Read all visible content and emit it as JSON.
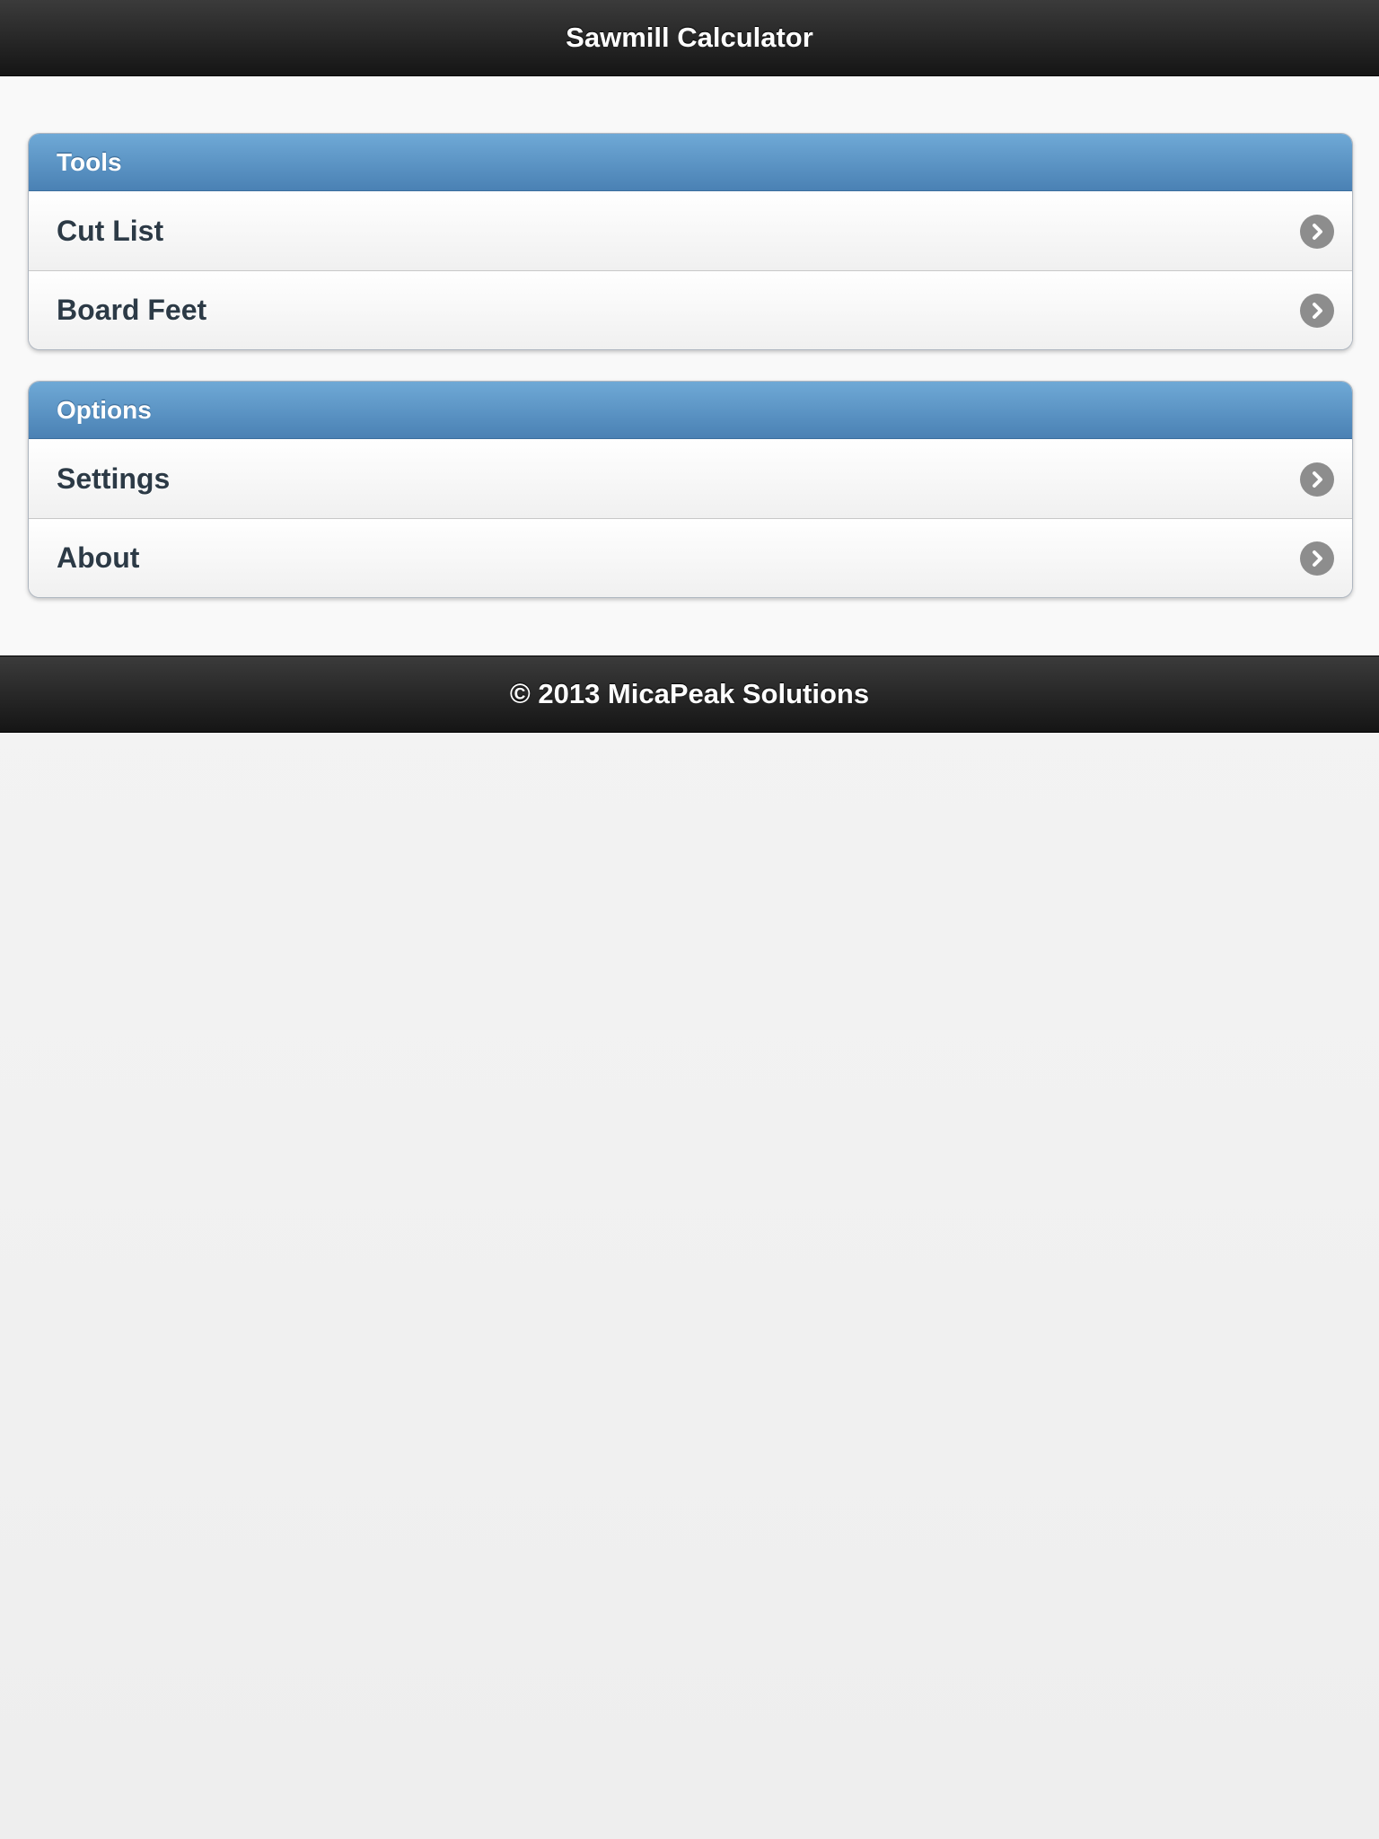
{
  "header": {
    "title": "Sawmill Calculator"
  },
  "groups": [
    {
      "label": "Tools",
      "items": [
        {
          "label": "Cut List",
          "icon": "chevron-right-circle-icon"
        },
        {
          "label": "Board Feet",
          "icon": "chevron-right-circle-icon"
        }
      ]
    },
    {
      "label": "Options",
      "items": [
        {
          "label": "Settings",
          "icon": "chevron-right-circle-icon"
        },
        {
          "label": "About",
          "icon": "chevron-right-circle-icon"
        }
      ]
    }
  ],
  "footer": {
    "text": "© 2013 MicaPeak Solutions"
  },
  "colors": {
    "header_bg": "#1c1c1c",
    "group_header_bg": "#5a93c6",
    "item_text": "#2c3a46",
    "chevron_bg": "#8d8d8d"
  }
}
